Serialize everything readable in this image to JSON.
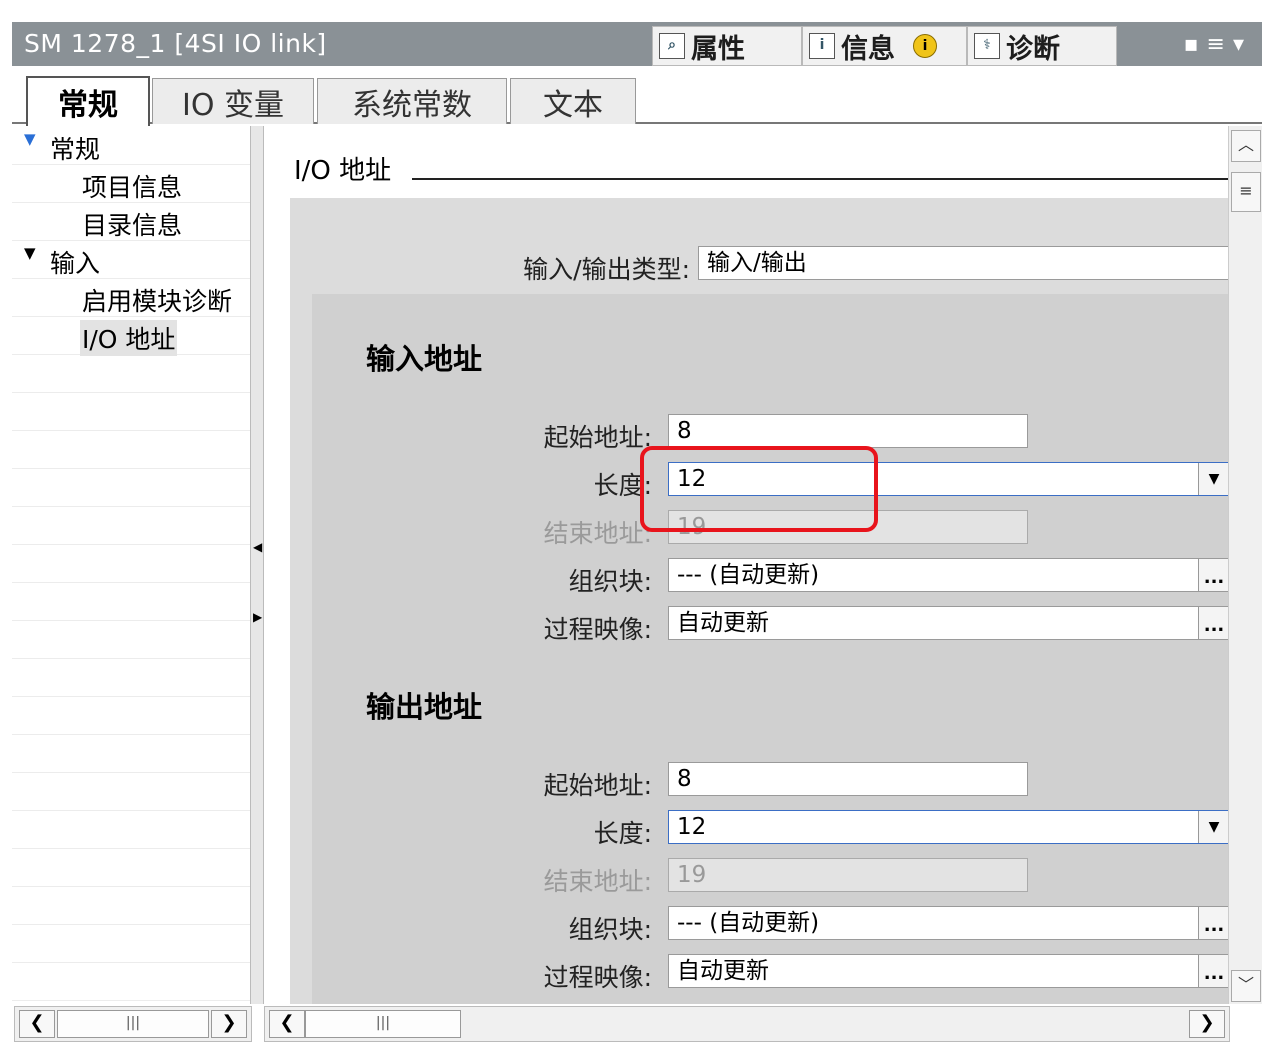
{
  "titlebar": {
    "title": "SM 1278_1 [4SI IO link]",
    "tabs": [
      {
        "label": "属性",
        "icon": "properties-icon",
        "glyph": "🔍"
      },
      {
        "label": "信息",
        "icon": "info-panel-icon",
        "glyph": "i"
      },
      {
        "label": "诊断",
        "icon": "diagnostics-icon",
        "glyph": "⚕"
      }
    ],
    "info_badge": "i"
  },
  "tabs": [
    "常规",
    "IO 变量",
    "系统常数",
    "文本"
  ],
  "tree": {
    "items": [
      {
        "label": "常规",
        "expanded": true
      },
      {
        "label": "项目信息"
      },
      {
        "label": "目录信息"
      },
      {
        "label": "输入",
        "expanded": true
      },
      {
        "label": "启用模块诊断"
      },
      {
        "label": "I/O 地址",
        "selected": true
      }
    ]
  },
  "content": {
    "group_title": "I/O 地址",
    "io_type_label": "输入/输出类型:",
    "io_type_value": "输入/输出",
    "input": {
      "heading": "输入地址",
      "start_label": "起始地址:",
      "start_value": "8",
      "length_label": "长度:",
      "length_value": "12",
      "end_label": "结束地址:",
      "end_value": "19",
      "ob_label": "组织块:",
      "ob_value": "--- (自动更新)",
      "pi_label": "过程映像:",
      "pi_value": "自动更新"
    },
    "output": {
      "heading": "输出地址",
      "start_label": "起始地址:",
      "start_value": "8",
      "length_label": "长度:",
      "length_value": "12",
      "end_label": "结束地址:",
      "end_value": "19",
      "ob_label": "组织块:",
      "ob_value": "--- (自动更新)",
      "pi_label": "过程映像:",
      "pi_value": "自动更新"
    }
  },
  "colors": {
    "highlight": "#e8141c",
    "titlebar": "#8a9196",
    "panel": "#d0d0d0"
  }
}
